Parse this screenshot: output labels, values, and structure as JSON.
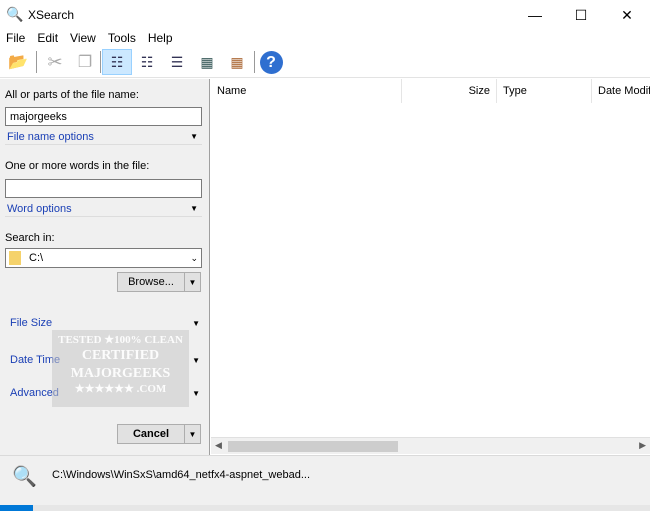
{
  "window": {
    "title": "XSearch",
    "min": "—",
    "max": "☐",
    "close": "✕"
  },
  "menu": [
    "File",
    "Edit",
    "View",
    "Tools",
    "Help"
  ],
  "left": {
    "filename_label": "All or parts of the file name:",
    "filename_value": "majorgeeks",
    "filename_options": "File name options",
    "words_label": "One or more words in the file:",
    "words_value": "",
    "word_options": "Word options",
    "search_in_label": "Search in:",
    "search_in_value": "C:\\",
    "browse": "Browse...",
    "file_size": "File Size",
    "date_time": "Date Time",
    "advanced": "Advanced",
    "cancel": "Cancel"
  },
  "watermark": [
    "TESTED ★100% CLEAN",
    "CERTIFIED",
    "MAJORGEEKS",
    "★★★★★★ .COM"
  ],
  "columns": [
    "Name",
    "Size",
    "Type",
    "Date Modif"
  ],
  "status": {
    "path": "C:\\Windows\\WinSxS\\amd64_netfx4-aspnet_webad..."
  },
  "progress": 0.05
}
